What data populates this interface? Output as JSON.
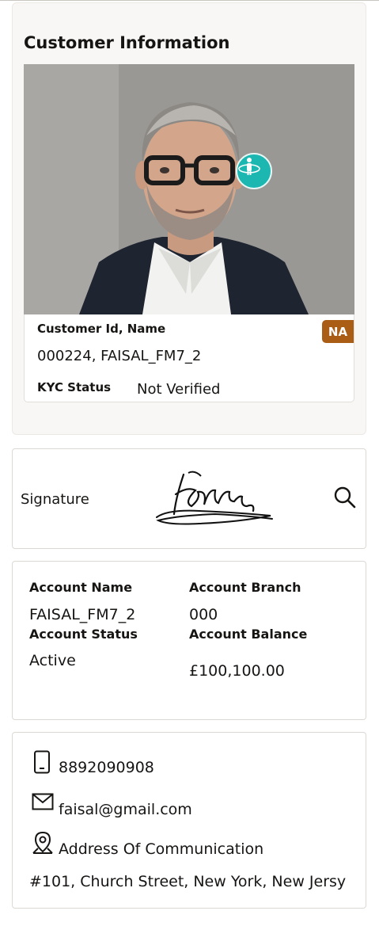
{
  "customer": {
    "section_title": "Customer Information",
    "id_name_label": "Customer Id, Name",
    "id_name_value": "000224, FAISAL_FM7_2",
    "kyc_label": "KYC Status",
    "kyc_value": "Not Verified",
    "badge": "NA",
    "photo_icon": "rotate-person-icon",
    "badge_color": "#aa5d14",
    "accent_color": "#1bb7b0"
  },
  "signature": {
    "label": "Signature",
    "action_icon": "search-icon"
  },
  "account": {
    "name_label": "Account Name",
    "name_value": "FAISAL_FM7_2",
    "branch_label": "Account Branch",
    "branch_value": "000",
    "status_label": "Account Status",
    "status_value": "Active",
    "balance_label": "Account Balance",
    "balance_value": "£100,100.00"
  },
  "contact": {
    "phone": "8892090908",
    "phone_icon": "mobile-phone-icon",
    "email": "faisal@gmail.com",
    "email_icon": "envelope-icon",
    "address_label": "Address Of Communication",
    "address_icon": "location-pin-icon",
    "address_value": "#101, Church Street, New York, New Jersy"
  }
}
